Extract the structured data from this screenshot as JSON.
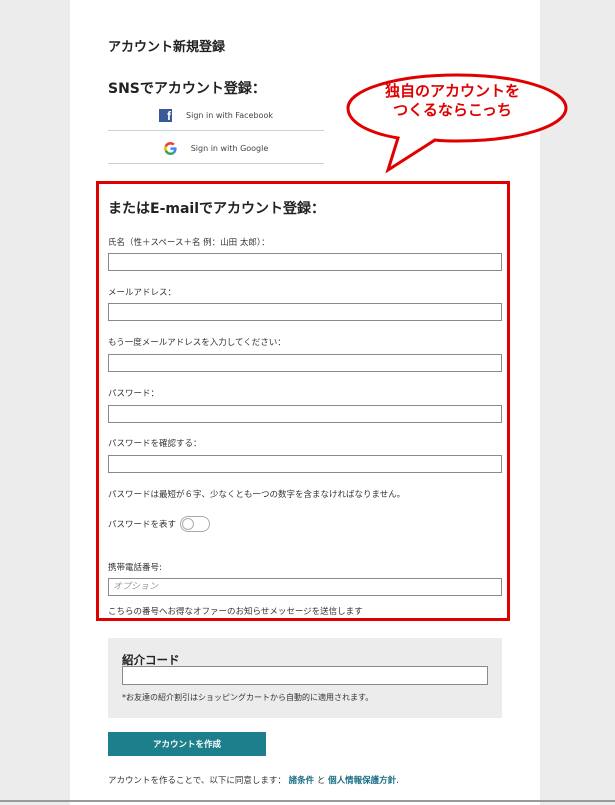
{
  "page": {
    "title": "アカウント新規登録",
    "sns_title": "SNSでアカウント登録：",
    "facebook_label": "Sign in with Facebook",
    "google_label": "Sign in with Google"
  },
  "callout": {
    "line1": "独自のアカウントを",
    "line2": "つくるならこっち",
    "color": "#e00000"
  },
  "email_form": {
    "title": "またはE-mailでアカウント登録：",
    "name_label": "氏名（性＋スペース＋名 例：山田 太郎）：",
    "email_label": "メールアドレス：",
    "email_confirm_label": "もう一度メールアドレスを入力してください：",
    "password_label": "パスワード：",
    "password_confirm_label": "パスワードを確認する：",
    "password_rule": "パスワードは最短が６字、少なくとも一つの数字を含まなければなりません。",
    "show_password_label": "パスワードを表す",
    "phone_label": "携帯電話番号:",
    "phone_placeholder": "オプション",
    "phone_note": "こちらの番号へお得なオファーのお知らせメッセージを送信します"
  },
  "referral": {
    "title": "紹介コード",
    "note": "*お友達の紹介割引はショッピングカートから自動的に適用されます。"
  },
  "footer": {
    "create_button": "アカウントを作成",
    "agree_prefix": "アカウントを作ることで、以下に同意します：",
    "terms_link": "諸条件",
    "and_text": "と",
    "privacy_link": "個人情報保護方針",
    "period": "."
  },
  "colors": {
    "accent": "#1e7f8c",
    "highlight_red": "#e00000",
    "facebook_blue": "#3b5998"
  }
}
